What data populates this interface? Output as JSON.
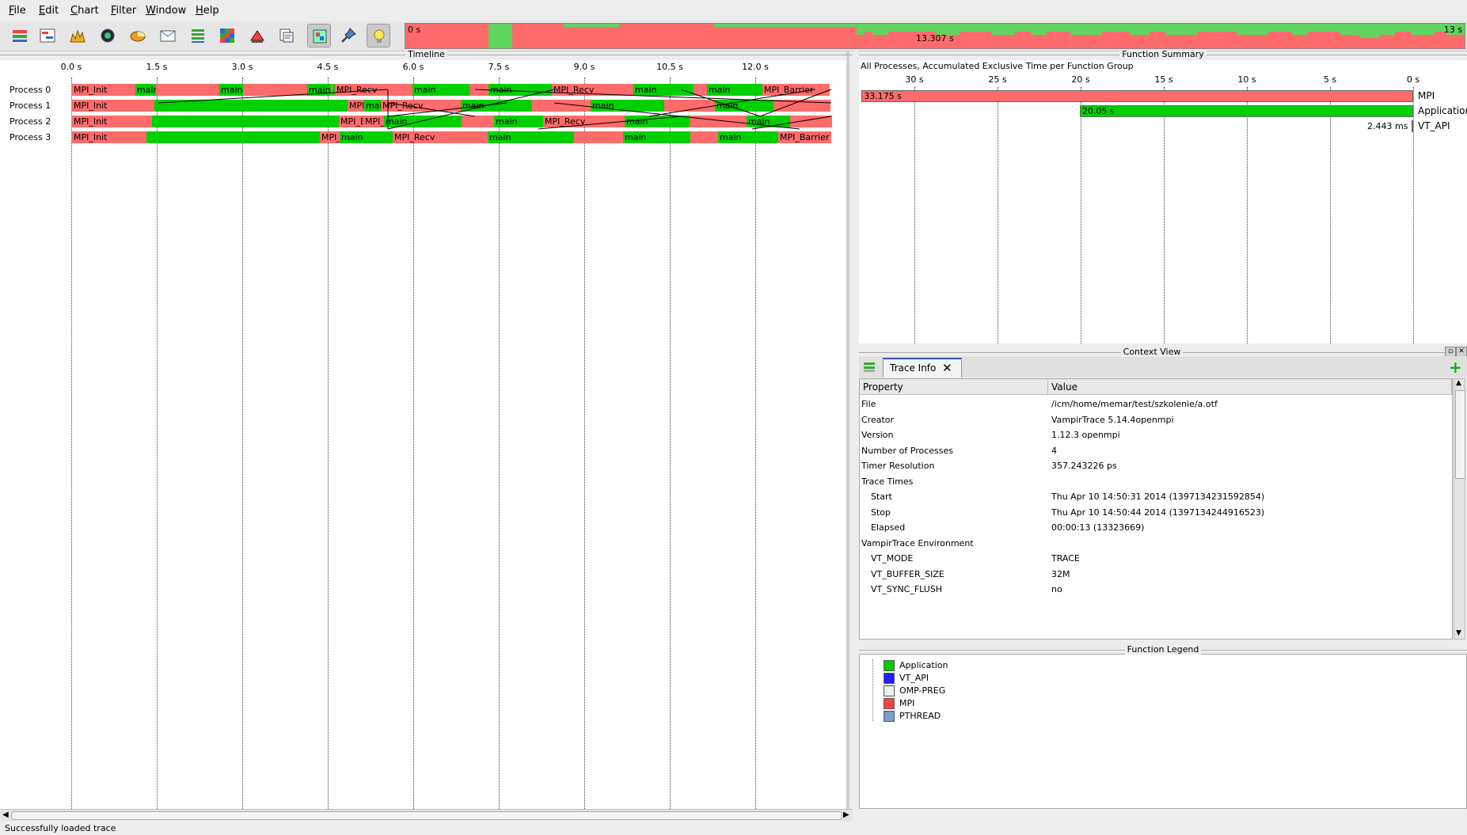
{
  "menubar": {
    "items": [
      "File",
      "Edit",
      "Chart",
      "Filter",
      "Window",
      "Help"
    ]
  },
  "toolbar": {
    "icons": [
      "master-timeline-icon",
      "process-timeline-icon",
      "counter-timeline-icon",
      "performance-radar-icon",
      "function-summary-icon",
      "message-summary-icon",
      "process-summary-icon",
      "communication-matrix-icon",
      "io-events-icon",
      "call-tree-icon",
      "zoom-icon",
      "pin-icon",
      "lightbulb-icon"
    ],
    "overview": {
      "start": "0 s",
      "mid": "13.307 s",
      "end": "13 s"
    }
  },
  "timeline": {
    "title": "Timeline",
    "ticks": [
      "0.0 s",
      "1.5 s",
      "3.0 s",
      "4.5 s",
      "6.0 s",
      "7.5 s",
      "9.0 s",
      "10.5 s",
      "12.0 s"
    ],
    "processes": [
      "Process 0",
      "Process 1",
      "Process 2",
      "Process 3"
    ],
    "rows": [
      [
        [
          "mpi",
          "MPI_Init"
        ],
        [
          "app",
          "main"
        ],
        [
          "mpi",
          ""
        ],
        [
          "app",
          "main"
        ],
        [
          "mpi",
          ""
        ],
        [
          "app",
          "main"
        ],
        [
          "mpi",
          ""
        ],
        [
          "app",
          ""
        ],
        [
          "mpi",
          "MPI_Recv"
        ],
        [
          "app",
          "main"
        ],
        [
          "mpi",
          ""
        ],
        [
          "app",
          "main"
        ],
        [
          "mpi",
          "MPI_Recv"
        ],
        [
          "app",
          "main"
        ],
        [
          "mpi",
          ""
        ],
        [
          "app",
          "main"
        ],
        [
          "mpi",
          "MPI_Barrier"
        ]
      ],
      [
        [
          "mpi",
          "MPI_Init"
        ],
        [
          "app",
          ""
        ],
        [
          "mpi",
          "MPI_Barrier"
        ],
        [
          "app",
          "main"
        ],
        [
          "mpi",
          "MPI_Recv"
        ],
        [
          "app",
          "main"
        ],
        [
          "mpi",
          ""
        ],
        [
          "app",
          "main"
        ],
        [
          "mpi",
          ""
        ],
        [
          "app",
          "main"
        ],
        [
          "mpi",
          ""
        ]
      ],
      [
        [
          "mpi",
          "MPI_Init"
        ],
        [
          "app",
          ""
        ],
        [
          "mpi",
          "MPI_Barrier"
        ],
        [
          "mpi",
          "MPI_Recv"
        ],
        [
          "app",
          "main"
        ],
        [
          "mpi",
          ""
        ],
        [
          "app",
          "main"
        ],
        [
          "mpi",
          "MPI_Recv"
        ],
        [
          "app",
          "main"
        ],
        [
          "mpi",
          ""
        ],
        [
          "app",
          "main"
        ],
        [
          "mpi",
          ""
        ]
      ],
      [
        [
          "mpi",
          "MPI_Init"
        ],
        [
          "app",
          ""
        ],
        [
          "mpi",
          "MPI_Barrier"
        ],
        [
          "app",
          "main"
        ],
        [
          "mpi",
          "MPI_Recv"
        ],
        [
          "app",
          "main"
        ],
        [
          "mpi",
          ""
        ],
        [
          "app",
          "main"
        ],
        [
          "mpi",
          ""
        ],
        [
          "app",
          "main"
        ],
        [
          "mpi",
          "MPI_Barrier"
        ]
      ]
    ]
  },
  "summary": {
    "title": "Function Summary",
    "subtitle": "All Processes, Accumulated Exclusive Time per Function Group",
    "ticks": [
      "30 s",
      "25 s",
      "20 s",
      "15 s",
      "10 s",
      "5 s",
      "0 s"
    ],
    "bars": [
      {
        "name": "MPI",
        "value_label": "33.175 s",
        "value": 33.175,
        "color": "#ff6b6b"
      },
      {
        "name": "Application",
        "value_label": "20.05 s",
        "value": 20.05,
        "color": "#00d000"
      },
      {
        "name": "VT_API",
        "value_label": "2.443 ms",
        "value": 0.002443,
        "color": "#2020ff"
      }
    ]
  },
  "context": {
    "title": "Context View",
    "tab_label": "Trace Info",
    "header_property": "Property",
    "header_value": "Value",
    "rows": [
      {
        "p": "File",
        "v": "/icm/home/memar/test/szkolenie/a.otf",
        "indent": false
      },
      {
        "p": "Creator",
        "v": "VampirTrace 5.14.4openmpi",
        "indent": false
      },
      {
        "p": "Version",
        "v": "1.12.3 openmpi",
        "indent": false
      },
      {
        "p": "Number of Processes",
        "v": "4",
        "indent": false
      },
      {
        "p": "Timer Resolution",
        "v": "357.243226 ps",
        "indent": false
      },
      {
        "p": "Trace Times",
        "v": "",
        "indent": false
      },
      {
        "p": "Start",
        "v": "Thu Apr 10 14:50:31 2014 (1397134231592854)",
        "indent": true
      },
      {
        "p": "Stop",
        "v": "Thu Apr 10 14:50:44 2014 (1397134244916523)",
        "indent": true
      },
      {
        "p": "Elapsed",
        "v": "00:00:13 (13323669)",
        "indent": true
      },
      {
        "p": "VampirTrace Environment",
        "v": "",
        "indent": false
      },
      {
        "p": "VT_MODE",
        "v": "TRACE",
        "indent": true
      },
      {
        "p": "VT_BUFFER_SIZE",
        "v": "32M",
        "indent": true
      },
      {
        "p": "VT_SYNC_FLUSH",
        "v": "no",
        "indent": true
      }
    ]
  },
  "legend": {
    "title": "Function Legend",
    "items": [
      {
        "label": "Application",
        "color": "#00d000"
      },
      {
        "label": "VT_API",
        "color": "#2020ff"
      },
      {
        "label": "OMP-PREG",
        "color": "#e8f2e8"
      },
      {
        "label": "MPI",
        "color": "#ff4040"
      },
      {
        "label": "PTHREAD",
        "color": "#7a9cd0"
      }
    ]
  },
  "status": "Successfully loaded trace"
}
